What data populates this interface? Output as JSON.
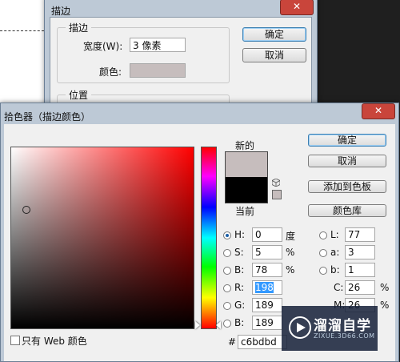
{
  "stroke_dialog": {
    "title": "描边",
    "group_stroke": "描边",
    "width_label": "宽度(W):",
    "width_value": "3 像素",
    "color_label": "颜色:",
    "color_value": "#c6bdbd",
    "group_position": "位置",
    "ok_label": "确定",
    "cancel_label": "取消"
  },
  "picker": {
    "title": "拾色器（描边颜色）",
    "new_label": "新的",
    "current_label": "当前",
    "new_color": "#c6bdbd",
    "current_color": "#000000",
    "buttons": {
      "ok": "确定",
      "cancel": "取消",
      "add_swatch": "添加到色板",
      "libraries": "颜色库"
    },
    "fields": {
      "H": {
        "label": "H:",
        "value": "0",
        "unit": "度",
        "selected": true
      },
      "S": {
        "label": "S:",
        "value": "5",
        "unit": "%"
      },
      "B": {
        "label": "B:",
        "value": "78",
        "unit": "%"
      },
      "R": {
        "label": "R:",
        "value": "198"
      },
      "G": {
        "label": "G:",
        "value": "189"
      },
      "Bb": {
        "label": "B:",
        "value": "189"
      },
      "L": {
        "label": "L:",
        "value": "77"
      },
      "a": {
        "label": "a:",
        "value": "3"
      },
      "b": {
        "label": "b:",
        "value": "1"
      },
      "C": {
        "label": "C:",
        "value": "26",
        "unit": "%"
      },
      "M": {
        "label": "M:",
        "value": "26",
        "unit": "%"
      }
    },
    "hex_label": "#",
    "hex_value": "c6bdbd",
    "web_only_label": "只有 Web 颜色"
  },
  "watermark": {
    "title": "溜溜自学",
    "subtitle": "ZIXUE.3D66.COM"
  }
}
